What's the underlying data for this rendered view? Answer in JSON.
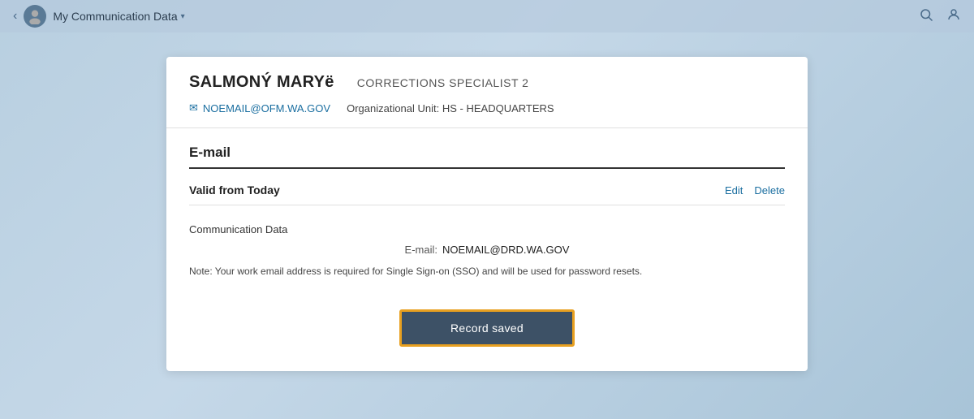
{
  "nav": {
    "back_label": "‹",
    "app_title": "My Communication Data",
    "dropdown_arrow": "▾",
    "search_icon": "🔍",
    "user_icon": "👤"
  },
  "person": {
    "name": "SALMONÝ MARYë",
    "job_title": "CORRECTIONS SPECIALIST 2",
    "email_header": "NOEMAIL@OFM.WA.GOV",
    "org_unit_label": "Organizational Unit:",
    "org_unit_value": "HS - HEADQUARTERS"
  },
  "section": {
    "title": "E-mail",
    "valid_from": "Valid from Today",
    "edit_label": "Edit",
    "delete_label": "Delete",
    "comm_data_label": "Communication Data",
    "email_field_label": "E-mail:",
    "email_value": "NOEMAIL@DRD.WA.GOV",
    "note": "Note: Your work email address is required for Single Sign-on (SSO) and will be used for password resets."
  },
  "button": {
    "record_saved": "Record saved"
  }
}
